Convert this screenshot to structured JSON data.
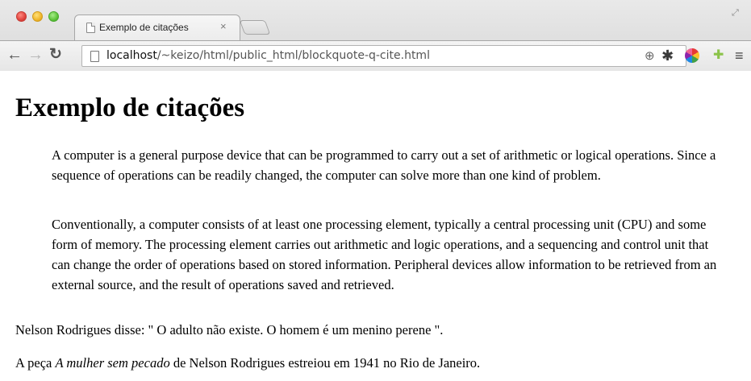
{
  "browser": {
    "tab_title": "Exemplo de citações",
    "tab_close": "×",
    "url_host": "localhost",
    "url_path": "/~keizo/html/public_html/blockquote-q-cite.html"
  },
  "icons": {
    "back": "back-arrow-icon",
    "forward": "forward-arrow-icon",
    "reload": "reload-icon",
    "zoom": "zoom-icon",
    "star": "bookmark-star-icon",
    "gear": "extension-gear-icon",
    "color": "extension-colorwheel-icon",
    "android": "extension-android-icon",
    "menu": "menu-icon"
  },
  "page": {
    "heading": "Exemplo de citações",
    "blockquote": [
      "A computer is a general purpose device that can be programmed to carry out a set of arithmetic or logical operations. Since a sequence of operations can be readily changed, the computer can solve more than one kind of problem.",
      "Conventionally, a computer consists of at least one processing element, typically a central processing unit (CPU) and some form of memory. The processing element carries out arithmetic and logic operations, and a sequencing and control unit that can change the order of operations based on stored information. Peripheral devices allow information to be retrieved from an external source, and the result of operations saved and retrieved."
    ],
    "quote_line": {
      "prefix": "Nelson Rodrigues disse: \"",
      "quote": "O adulto não existe. O homem é um menino perene",
      "suffix": "\"."
    },
    "cite_line": {
      "prefix": "A peça ",
      "cite": "A mulher sem pecado",
      "suffix": " de Nelson Rodrigues estreiou em 1941 no Rio de Janeiro."
    }
  }
}
